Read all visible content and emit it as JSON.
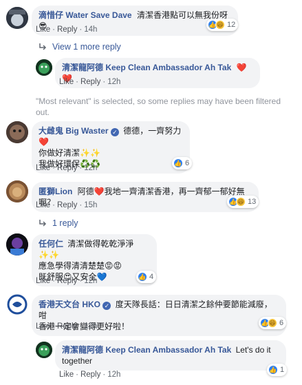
{
  "actions": {
    "like": "Like",
    "reply": "Reply",
    "separator": "·"
  },
  "c1": {
    "name": "滴惜仔 Water Save Dave",
    "text": "清潔香港點可以無我份呀😎",
    "time": "14h",
    "reaction_count": "12"
  },
  "view_more": {
    "label": "View 1 more reply"
  },
  "r1": {
    "name": "清潔龍阿德 Keep Clean Ambassador Ah Tak",
    "text": "❤️ ❤️",
    "time": "12h"
  },
  "notice": {
    "text": "\"Most relevant\" is selected, so some replies may have been filtered out."
  },
  "c2": {
    "name": "大雌鬼 Big Waster",
    "text1": "德德，一齊努力❤️",
    "text2": "你做好清潔✨✨",
    "text3": "我做好環保♻️♻️",
    "time": "12h",
    "reaction_count": "6"
  },
  "c3": {
    "name": "匿獅Lion",
    "text": "阿德❤️我地一齊清潔香港，再一齊郁一郁好無啊？",
    "time": "15h",
    "reaction_count": "13"
  },
  "reply_link": {
    "label": "1 reply"
  },
  "c4": {
    "name": "任何仁",
    "text1": "清潔做得乾乾淨淨✨✨",
    "text2": "應急學得清清楚楚😡😡",
    "text3": "既舒服😍又安全💙",
    "time": "12h",
    "reaction_count": "4"
  },
  "c5": {
    "name": "香港天文台 HKO",
    "text1": "度天隊長話：日日清潔之餘仲要節能減廢，咁",
    "text2": "香港一定會變得更好啦！",
    "time": "12h",
    "reaction_count": "6"
  },
  "r2": {
    "name": "清潔龍阿德 Keep Clean Ambassador Ah Tak",
    "text1": "Let's do it",
    "text2": "together",
    "time": "12h",
    "reaction_count": "1"
  },
  "icons": {
    "like": "like-reaction-icon",
    "haha": "haha-reaction-icon",
    "love": "love-reaction-icon",
    "verified": "verified-badge-icon",
    "reply_arrow": "reply-arrow-icon"
  },
  "colors": {
    "name_link": "#385898",
    "bubble_bg": "#f2f3f5",
    "meta_gray": "#606770",
    "like_blue": "#2e80f2"
  }
}
